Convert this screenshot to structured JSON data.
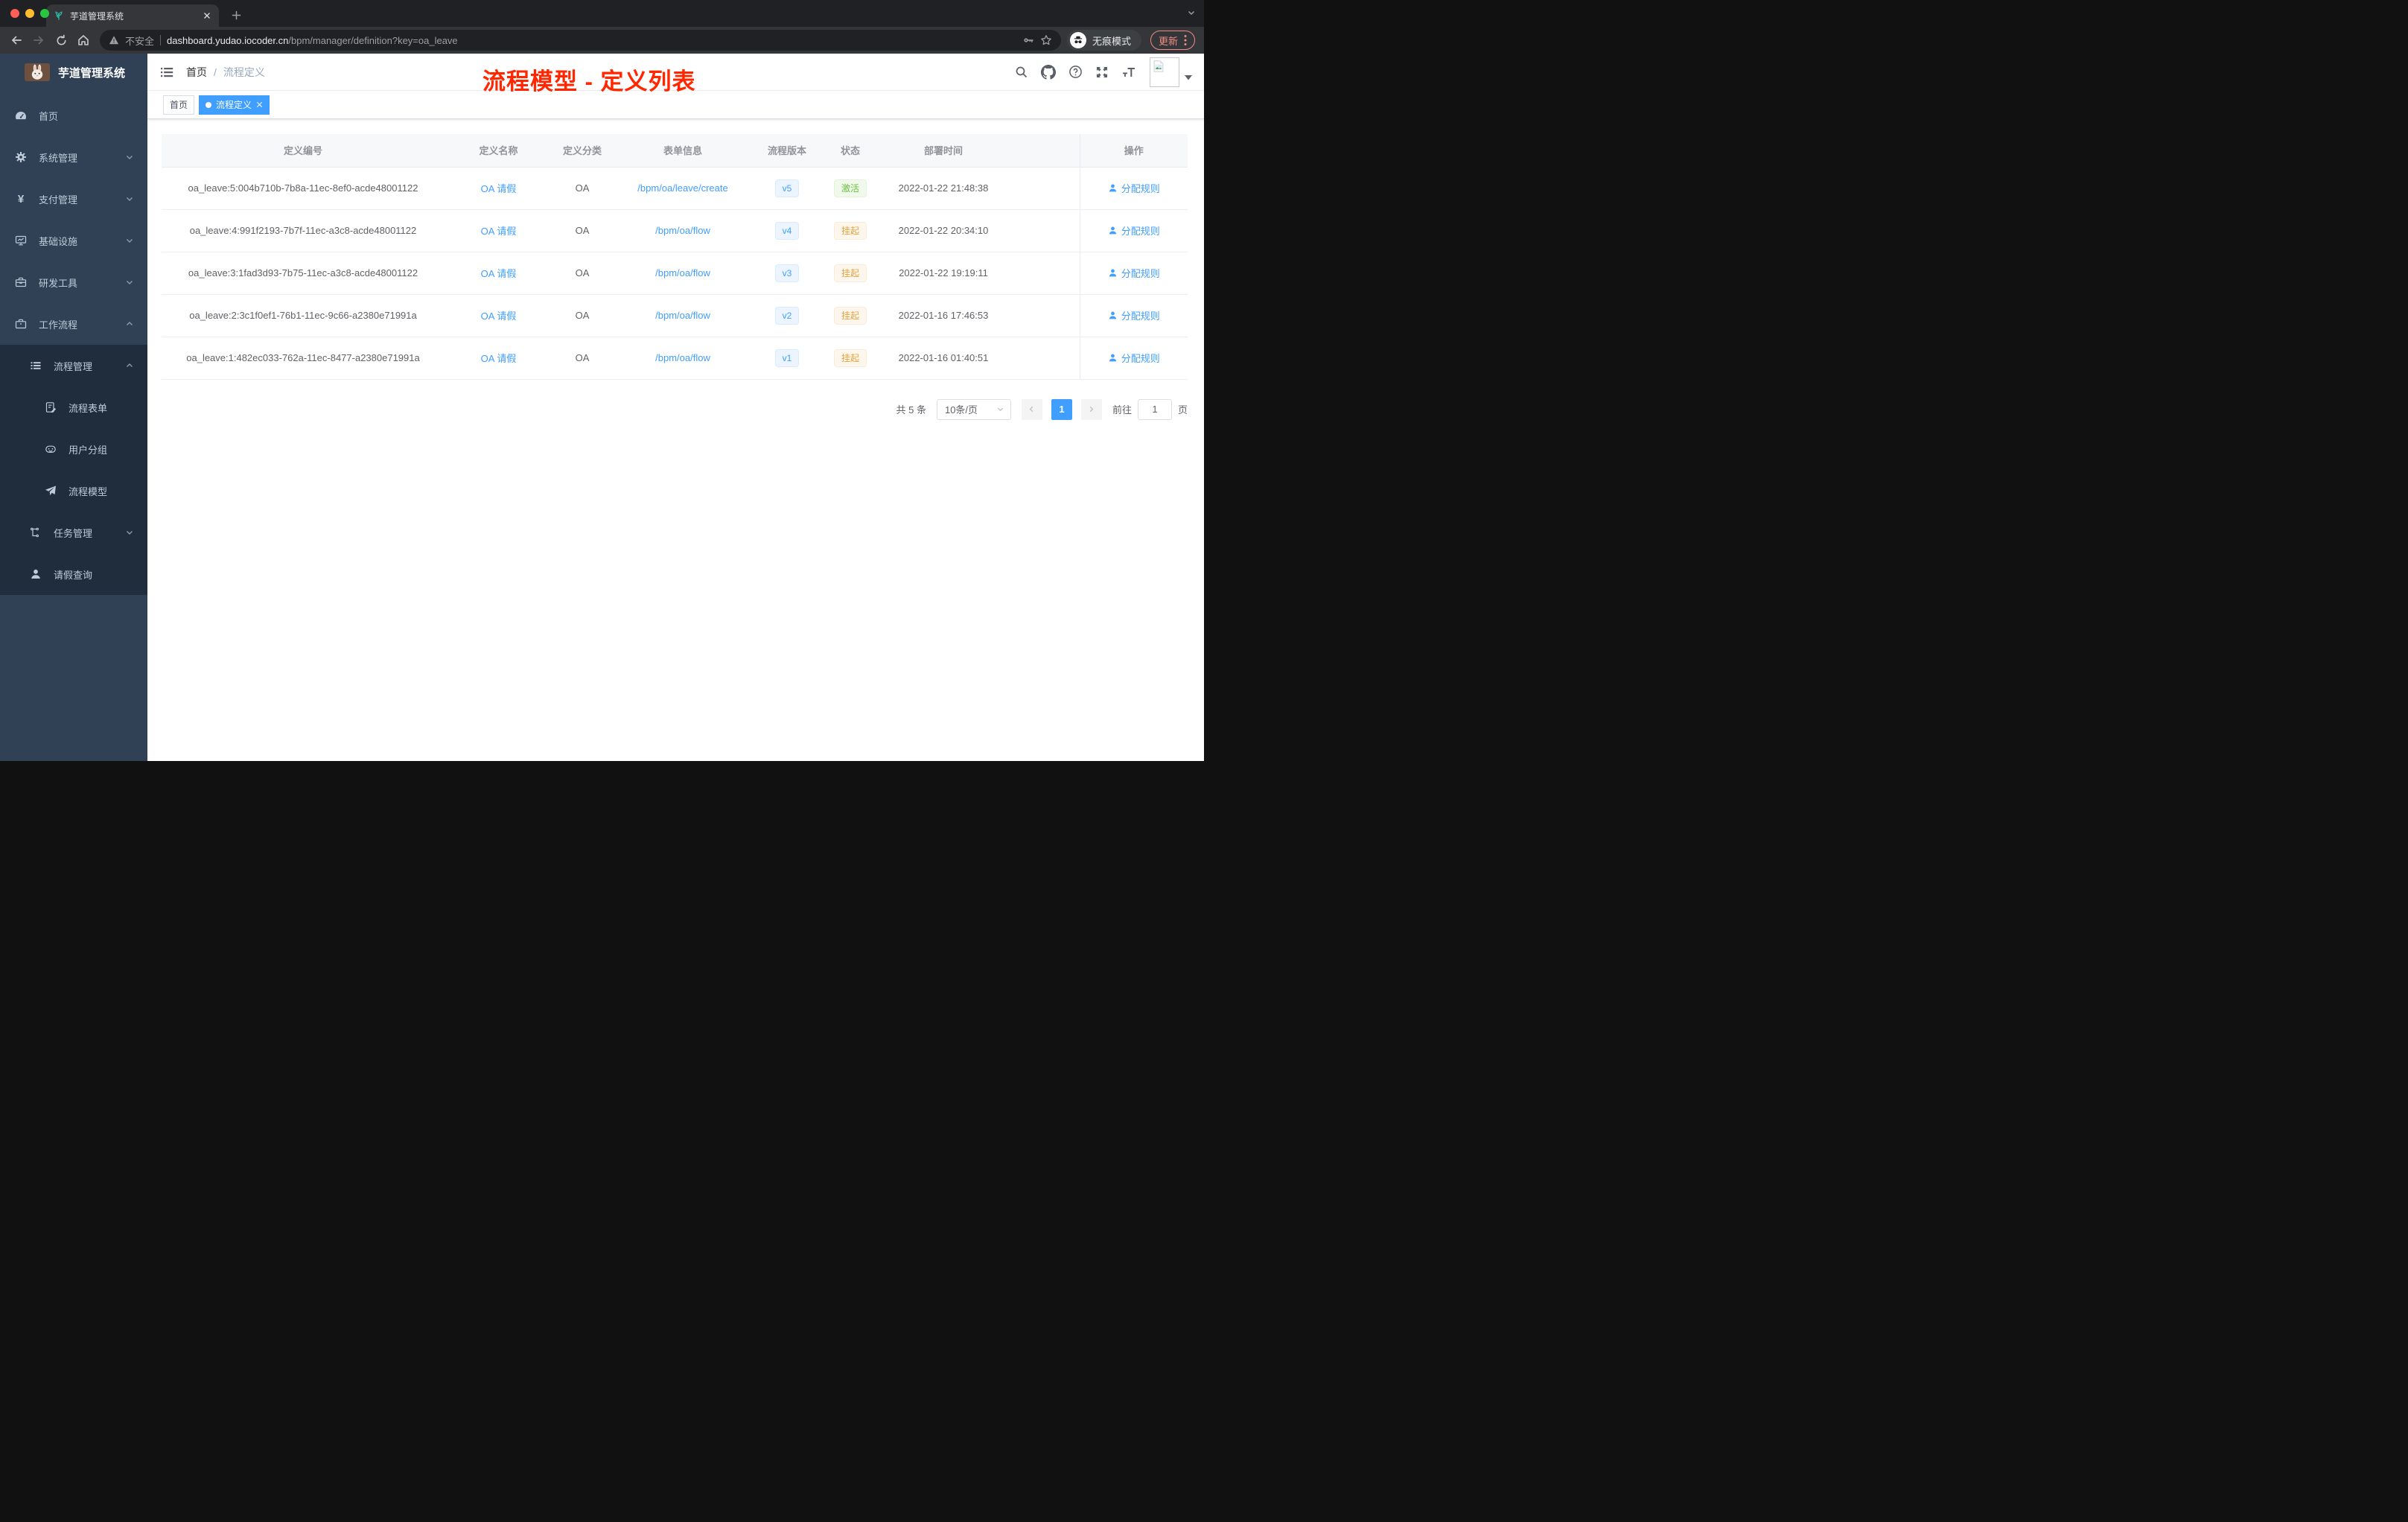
{
  "colors": {
    "accent": "#409eff",
    "sidebar_bg": "#304156",
    "submenu_bg": "#1f2d3d",
    "status_active": "#67c23a",
    "status_suspended": "#e6a23c",
    "annotation_red": "#ff2600",
    "tag_active_bg": "#409eff"
  },
  "browser": {
    "tab_title": "芋道管理系统",
    "security_label": "不安全",
    "url_host": "dashboard.yudao.iocoder.cn",
    "url_path": "/bpm/manager/definition?key=oa_leave",
    "incognito_label": "无痕模式",
    "update_label": "更新"
  },
  "annotation": {
    "text": "流程模型 - 定义列表"
  },
  "sidebar": {
    "logo_title": "芋道管理系统",
    "items": [
      {
        "label": "首页",
        "icon": "dashboard-icon"
      },
      {
        "label": "系统管理",
        "icon": "gear-icon"
      },
      {
        "label": "支付管理",
        "icon": "yen-icon"
      },
      {
        "label": "基础设施",
        "icon": "monitor-icon"
      },
      {
        "label": "研发工具",
        "icon": "toolbox-icon"
      },
      {
        "label": "工作流程",
        "icon": "briefcase-icon"
      },
      {
        "label": "流程管理",
        "icon": "list-icon"
      },
      {
        "label": "流程表单",
        "icon": "form-icon"
      },
      {
        "label": "用户分组",
        "icon": "robot-icon"
      },
      {
        "label": "流程模型",
        "icon": "send-icon"
      },
      {
        "label": "任务管理",
        "icon": "tree-icon"
      },
      {
        "label": "请假查询",
        "icon": "user-icon"
      }
    ]
  },
  "breadcrumb": {
    "home": "首页",
    "separator": "/",
    "current": "流程定义"
  },
  "tags": [
    {
      "label": "首页",
      "active": false
    },
    {
      "label": "流程定义",
      "active": true
    }
  ],
  "table": {
    "columns": [
      "定义编号",
      "定义名称",
      "定义分类",
      "表单信息",
      "流程版本",
      "状态",
      "部署时间",
      "操作"
    ],
    "rows": [
      {
        "id": "oa_leave:5:004b710b-7b8a-11ec-8ef0-acde48001122",
        "name": "OA 请假",
        "category": "OA",
        "form": "/bpm/oa/leave/create",
        "version": "v5",
        "status": "激活",
        "status_type": "active",
        "deploy_time": "2022-01-22 21:48:38",
        "action": "分配规则"
      },
      {
        "id": "oa_leave:4:991f2193-7b7f-11ec-a3c8-acde48001122",
        "name": "OA 请假",
        "category": "OA",
        "form": "/bpm/oa/flow",
        "version": "v4",
        "status": "挂起",
        "status_type": "suspended",
        "deploy_time": "2022-01-22 20:34:10",
        "action": "分配规则"
      },
      {
        "id": "oa_leave:3:1fad3d93-7b75-11ec-a3c8-acde48001122",
        "name": "OA 请假",
        "category": "OA",
        "form": "/bpm/oa/flow",
        "version": "v3",
        "status": "挂起",
        "status_type": "suspended",
        "deploy_time": "2022-01-22 19:19:11",
        "action": "分配规则"
      },
      {
        "id": "oa_leave:2:3c1f0ef1-76b1-11ec-9c66-a2380e71991a",
        "name": "OA 请假",
        "category": "OA",
        "form": "/bpm/oa/flow",
        "version": "v2",
        "status": "挂起",
        "status_type": "suspended",
        "deploy_time": "2022-01-16 17:46:53",
        "action": "分配规则"
      },
      {
        "id": "oa_leave:1:482ec033-762a-11ec-8477-a2380e71991a",
        "name": "OA 请假",
        "category": "OA",
        "form": "/bpm/oa/flow",
        "version": "v1",
        "status": "挂起",
        "status_type": "suspended",
        "deploy_time": "2022-01-16 01:40:51",
        "action": "分配规则"
      }
    ]
  },
  "pagination": {
    "total_label": "共 5 条",
    "page_size_label": "10条/页",
    "current_page": "1",
    "goto_label": "前往",
    "goto_value": "1",
    "page_unit_label": "页"
  }
}
